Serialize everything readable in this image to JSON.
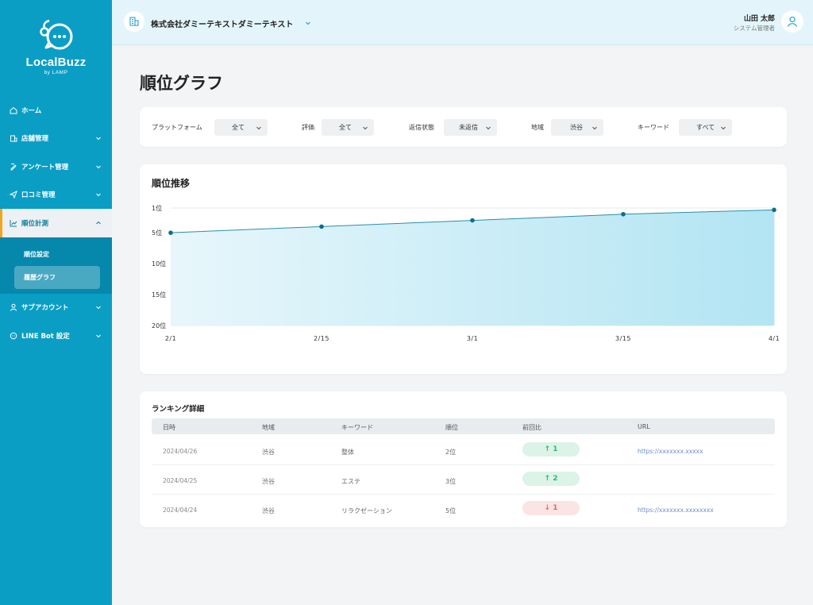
{
  "app": {
    "name": "LocalBuzz",
    "sub": "by LAMP"
  },
  "sidebar": {
    "items": [
      {
        "label": "ホーム",
        "icon": "home-icon"
      },
      {
        "label": "店舗管理",
        "icon": "store-icon"
      },
      {
        "label": "アンケート管理",
        "icon": "survey-icon"
      },
      {
        "label": "口コミ管理",
        "icon": "send-icon"
      },
      {
        "label": "順位計測",
        "icon": "chart-icon"
      },
      {
        "label": "サブアカウント",
        "icon": "user-icon"
      },
      {
        "label": "LINE Bot 設定",
        "icon": "chat-icon"
      }
    ],
    "submenu": [
      {
        "label": "順位設定"
      },
      {
        "label": "履歴グラフ"
      }
    ]
  },
  "header": {
    "company": "株式会社ダミーテキストダミーテキスト",
    "user_name": "山田 太郎",
    "user_role": "システム管理者"
  },
  "page": {
    "title": "順位グラフ"
  },
  "filters": [
    {
      "label": "プラットフォーム",
      "value": "全て"
    },
    {
      "label": "評価",
      "value": "全て"
    },
    {
      "label": "返信状態",
      "value": "未返信"
    },
    {
      "label": "地域",
      "value": "渋谷"
    },
    {
      "label": "キーワード",
      "value": "すべて"
    }
  ],
  "chart": {
    "title": "順位推移"
  },
  "chart_data": {
    "type": "area",
    "x": [
      "2/1",
      "2/15",
      "3/1",
      "3/15",
      "4/1"
    ],
    "series": [
      {
        "values": [
          5.0,
          4.0,
          3.0,
          2.0,
          1.3
        ]
      }
    ],
    "yticks": [
      "1位",
      "5位",
      "10位",
      "15位",
      "20位"
    ],
    "yvalues": [
      1,
      5,
      10,
      15,
      20
    ],
    "ylim": [
      1,
      20
    ],
    "y_inverted": true,
    "grid": true,
    "colors": {
      "line": "#2a8fab",
      "point": "#0d6d8a",
      "fill_top": "#aee3f2",
      "fill_bottom": "#e6f6fb"
    }
  },
  "ranking": {
    "title": "ランキング詳細",
    "headers": [
      "日時",
      "地域",
      "キーワード",
      "順位",
      "前回比",
      "URL"
    ],
    "rows": [
      {
        "date": "2024/04/26",
        "region": "渋谷",
        "keyword": "整体",
        "rank": "2位",
        "change": "↑ 1",
        "dir": "up",
        "url": "https://xxxxxxx.xxxxx"
      },
      {
        "date": "2024/04/25",
        "region": "渋谷",
        "keyword": "エステ",
        "rank": "3位",
        "change": "↑ 2",
        "dir": "up",
        "url": ""
      },
      {
        "date": "2024/04/24",
        "region": "渋谷",
        "keyword": "リラクゼーション",
        "rank": "5位",
        "change": "↓ 1",
        "dir": "down",
        "url": "https://xxxxxxx.xxxxxxxx"
      }
    ]
  },
  "colors": {
    "sidebar": "#0a9ec5",
    "accent": "#f2a521",
    "up": "#2bb673",
    "down": "#e06464"
  }
}
